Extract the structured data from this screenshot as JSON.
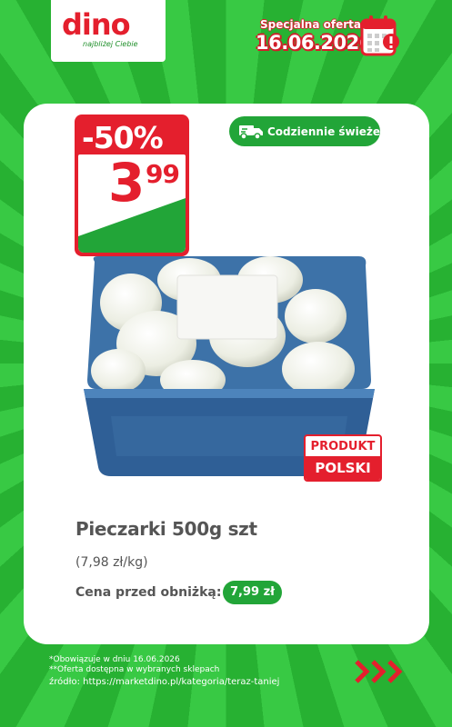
{
  "brand": {
    "name": "dino",
    "tagline": "najbliżej Ciebie"
  },
  "offer": {
    "label": "Specjalna oferta",
    "date": "16.06.2026",
    "icon": "calendar-alert-icon"
  },
  "price_tag": {
    "discount": "-50%",
    "price_int": "3",
    "price_dec": "99"
  },
  "fresh_badge": {
    "label": "Codziennie świeże",
    "icon": "truck-icon"
  },
  "origin_badge": {
    "line1": "PRODUKT",
    "line2": "POLSKI"
  },
  "product": {
    "name": "Pieczarki 500g szt",
    "unit_price": "(7,98 zł/kg)",
    "before_label": "Cena przed obniżką:",
    "before_value": "7,99 zł"
  },
  "footer": {
    "note1": "*Obowiązuje w dniu 16.06.2026",
    "note2": "**Oferta dostępna w wybranych sklepach",
    "source": "źródło: https://marketdino.pl/kategoria/teraz-taniej",
    "arrows_icon": "chevrons-right-icon"
  },
  "colors": {
    "brand_red": "#e41f2d",
    "brand_green": "#22a538",
    "background_green": "#2fbe3a"
  }
}
